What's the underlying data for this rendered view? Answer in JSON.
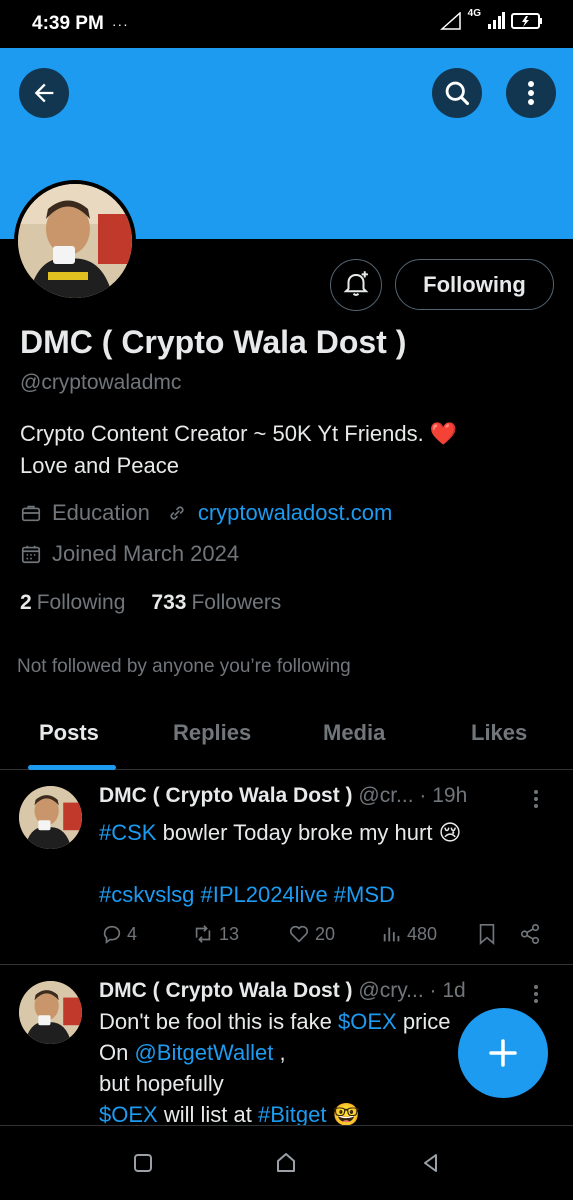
{
  "status_bar": {
    "time": "4:39 PM",
    "dots": "···",
    "network": "4G"
  },
  "profile": {
    "display_name": "DMC ( Crypto Wala Dost )",
    "handle": "@cryptowaladmc",
    "bio_line1": "Crypto Content Creator ~ 50K Yt Friends. ",
    "bio_heart": "❤️",
    "bio_line2": "Love and Peace",
    "category": "Education",
    "website": "cryptowaladost.com",
    "joined": "Joined March 2024",
    "following_count": "2",
    "following_label": "Following",
    "followers_count": "733",
    "followers_label": "Followers",
    "not_followed": "Not followed by anyone you’re following",
    "follow_button": "Following"
  },
  "tabs": [
    {
      "label": "Posts",
      "active": true
    },
    {
      "label": "Replies",
      "active": false
    },
    {
      "label": "Media",
      "active": false
    },
    {
      "label": "Likes",
      "active": false
    }
  ],
  "tweets": [
    {
      "name": "DMC ( Crypto Wala Dost )",
      "handle": "@cr...",
      "time": "· 19h",
      "hashtag1": "#CSK",
      "text1": " bowler Today broke my hurt 😢",
      "hashtags_line": "#cskvslsg #IPL2024live #MSD",
      "replies": "4",
      "reposts": "13",
      "likes": "20",
      "views": "480"
    },
    {
      "name": "DMC ( Crypto Wala Dost )",
      "handle": "@cry...",
      "time": "· 1d",
      "line1_text": "Don't be fool this is fake ",
      "line1_tag": "$OEX",
      "line1_tail": " price",
      "line2_text": "On ",
      "line2_tag": "@BitgetWallet",
      "line2_tail": "  ,",
      "line3": "but hopefully",
      "line4_tag1": "$OEX",
      "line4_text": " will list at ",
      "line4_tag2": "#Bitget",
      "line4_emoji": " 🤓"
    }
  ],
  "colors": {
    "accent": "#1d9bf0",
    "background": "#000000",
    "muted": "#71767b",
    "text": "#e7e9ea"
  },
  "icons": [
    "back-arrow-icon",
    "search-icon",
    "more-vertical-icon",
    "bell-plus-icon",
    "briefcase-icon",
    "link-icon",
    "calendar-icon",
    "reply-icon",
    "repost-icon",
    "heart-icon",
    "views-icon",
    "bookmark-icon",
    "share-icon",
    "plus-icon"
  ]
}
